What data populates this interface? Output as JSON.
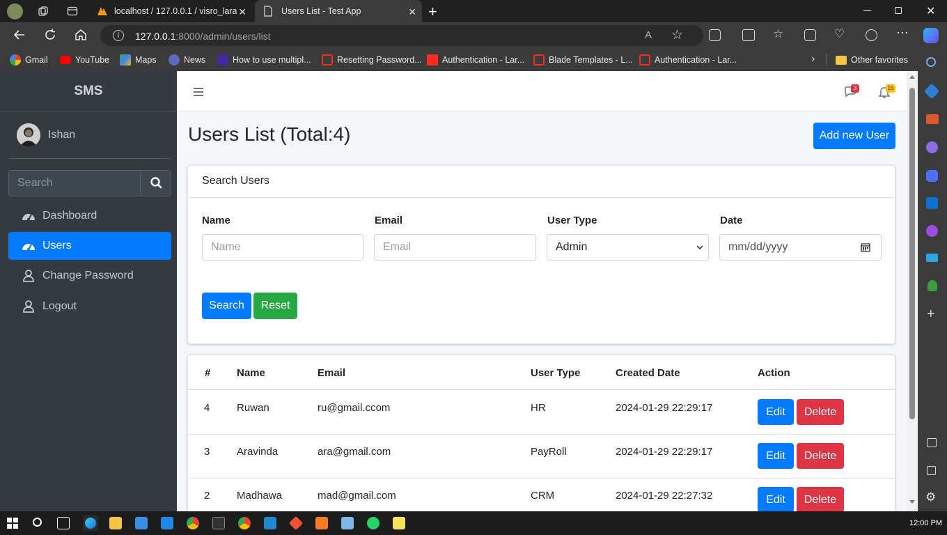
{
  "browser": {
    "tabs": [
      {
        "title": "localhost / 127.0.0.1 / visro_lara_"
      },
      {
        "title": "Users List - Test App"
      }
    ],
    "url_host": "127.0.0.1",
    "url_rest": ":8000/admin/users/list",
    "bookmarks": [
      "Gmail",
      "YouTube",
      "Maps",
      "News",
      "How to use multipl...",
      "Resetting Password...",
      "Authentication - Lar...",
      "Blade Templates - L...",
      "Authentication - Lar..."
    ],
    "other_favorites": "Other favorites"
  },
  "sidebar": {
    "brand": "SMS",
    "user": "Ishan",
    "search_placeholder": "Search",
    "items": [
      {
        "label": "Dashboard",
        "icon": "tachometer-icon"
      },
      {
        "label": "Users",
        "icon": "tachometer-icon",
        "active": true
      },
      {
        "label": "Change Password",
        "icon": "user-icon"
      },
      {
        "label": "Logout",
        "icon": "user-icon"
      }
    ]
  },
  "topnav": {
    "messages_count": "3",
    "notifications_count": "15"
  },
  "page": {
    "title": "Users List (Total:4)",
    "add_button": "Add new User"
  },
  "search_card": {
    "title": "Search Users",
    "name_label": "Name",
    "name_placeholder": "Name",
    "email_label": "Email",
    "email_placeholder": "Email",
    "type_label": "User Type",
    "type_selected": "Admin",
    "date_label": "Date",
    "date_placeholder": "mm/dd/yyyy",
    "search_button": "Search",
    "reset_button": "Reset"
  },
  "table": {
    "headers": [
      "#",
      "Name",
      "Email",
      "User Type",
      "Created Date",
      "Action"
    ],
    "rows": [
      {
        "id": "4",
        "name": "Ruwan",
        "email": "ru@gmail.ccom",
        "type": "HR",
        "created": "2024-01-29 22:29:17"
      },
      {
        "id": "3",
        "name": "Aravinda",
        "email": "ara@gmail.com",
        "type": "PayRoll",
        "created": "2024-01-29 22:29:17"
      },
      {
        "id": "2",
        "name": "Madhawa",
        "email": "mad@gmail.com",
        "type": "CRM",
        "created": "2024-01-29 22:27:32"
      }
    ],
    "edit_label": "Edit",
    "delete_label": "Delete"
  },
  "taskbar": {
    "clock": "12:00 PM"
  },
  "colors": {
    "primary": "#007bff",
    "success": "#28a745",
    "danger": "#dc3545",
    "sidebar": "#343a40"
  }
}
